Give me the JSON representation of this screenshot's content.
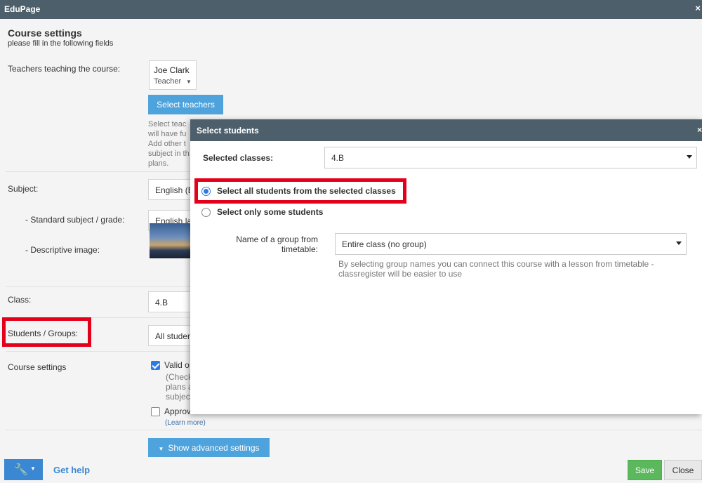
{
  "app": {
    "title": "EduPage",
    "close": "×"
  },
  "form": {
    "heading": "Course settings",
    "subheading": "please fill in the following fields",
    "teachers": {
      "label": "Teachers teaching the course:",
      "card_name": "Joe Clark",
      "card_role": "Teacher",
      "select_button": "Select teachers",
      "help_lines": [
        "Select teac",
        "will have fu",
        "Add other t",
        "subject in th",
        "plans."
      ]
    },
    "subject": {
      "label": "Subject:",
      "value": "English (E"
    },
    "standard": {
      "label": "- Standard subject / grade:",
      "value": "English la"
    },
    "image": {
      "label": "- Descriptive image:"
    },
    "class": {
      "label": "Class:",
      "value": "4.B"
    },
    "students": {
      "label": "Students / Groups:",
      "value": "All studen"
    },
    "course_settings": {
      "label": "Course settings",
      "valid_label": "Valid o",
      "valid_help": [
        "(Check",
        "plans a",
        "subjec"
      ],
      "approve_label": "Approv",
      "learn_more": "(Learn more)"
    },
    "advanced_button": "Show advanced settings"
  },
  "footer": {
    "get_help": "Get help",
    "save": "Save",
    "close": "Close"
  },
  "modal": {
    "title": "Select students",
    "close": "×",
    "selected_classes_label": "Selected classes:",
    "selected_classes_value": "4.B",
    "radio_all": "Select all students from the selected classes",
    "radio_some": "Select only some students",
    "group_label": "Name of a group from timetable:",
    "group_value": "Entire class (no group)",
    "group_help": "By selecting group names you can connect this course with a lesson from timetable - classregister will be easier to use"
  }
}
